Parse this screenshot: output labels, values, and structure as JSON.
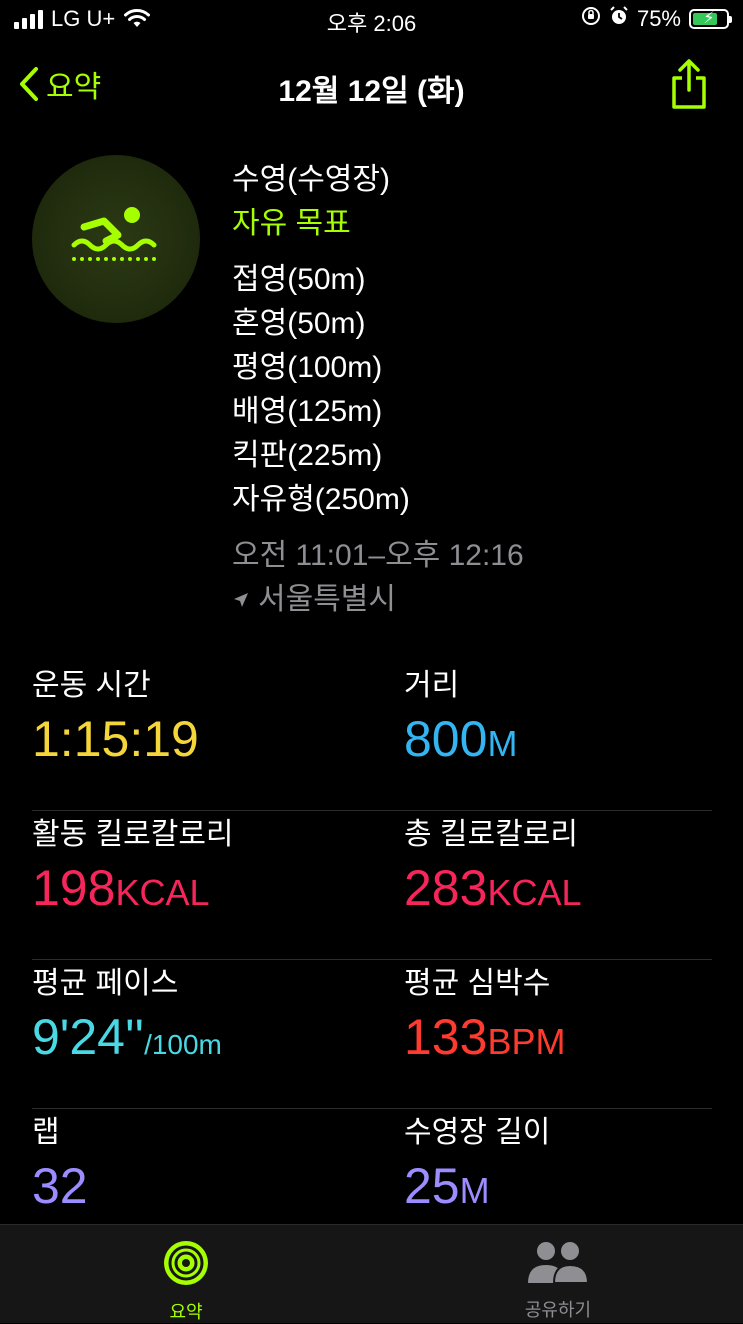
{
  "status": {
    "carrier": "LG U+",
    "time": "오후 2:06",
    "battery_percent": "75%",
    "battery_level": 0.75,
    "icons": [
      "signal-icon",
      "wifi-icon",
      "orientation-lock-icon",
      "alarm-icon",
      "battery-icon"
    ]
  },
  "nav": {
    "back_label": "요약",
    "title": "12월 12일 (화)"
  },
  "workout": {
    "type": "수영(수영장)",
    "goal": "자유 목표",
    "strokes": [
      "접영(50m)",
      "혼영(50m)",
      "평영(100m)",
      "배영(125m)",
      "킥판(225m)",
      "자유형(250m)"
    ],
    "time_range": "오전 11:01–오후 12:16",
    "location": "서울특별시"
  },
  "metrics": {
    "workout_time": {
      "label": "운동 시간",
      "value": "1:15:19",
      "color": "#f5d63a"
    },
    "distance": {
      "label": "거리",
      "value": "800",
      "unit": "M",
      "color": "#33b5f2"
    },
    "active_kcal": {
      "label": "활동 킬로칼로리",
      "value": "198",
      "unit": "KCAL",
      "color": "#f7265a"
    },
    "total_kcal": {
      "label": "총 킬로칼로리",
      "value": "283",
      "unit": "KCAL",
      "color": "#f7265a"
    },
    "avg_pace": {
      "label": "평균 페이스",
      "value": "9'24''",
      "unit": "/100m",
      "color": "#4ad9e4"
    },
    "avg_hr": {
      "label": "평균 심박수",
      "value": "133",
      "unit": "BPM",
      "color": "#ff3b30"
    },
    "laps": {
      "label": "랩",
      "value": "32",
      "color": "#9b8cff"
    },
    "pool_length": {
      "label": "수영장 길이",
      "value": "25",
      "unit": "M",
      "color": "#9b8cff"
    }
  },
  "tabbar": {
    "summary_label": "요약",
    "sharing_label": "공유하기"
  },
  "colors": {
    "accent": "#a6ff00",
    "secondary_text": "#8e8e93"
  }
}
